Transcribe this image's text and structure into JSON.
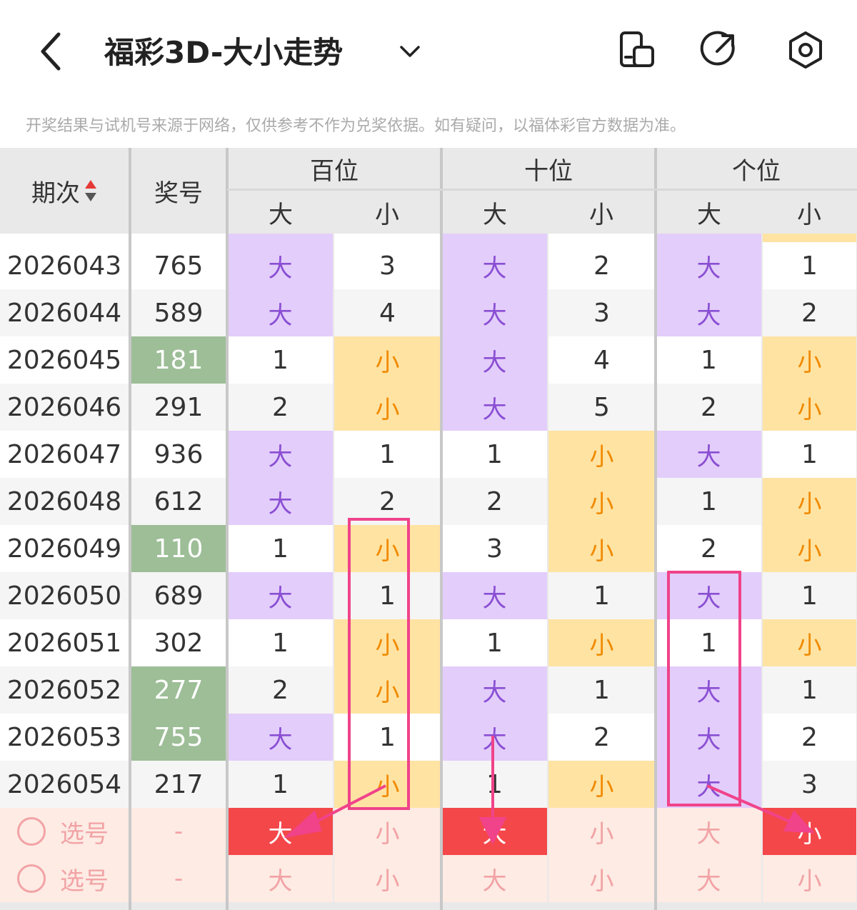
{
  "header": {
    "title": "福彩3D-大小走势",
    "icons": [
      "back-icon",
      "chevron-down-icon",
      "device-icon",
      "share-icon",
      "settings-icon"
    ]
  },
  "disclaimer": "开奖结果与试机号来源于网络，仅供参考不作为兑奖依据。如有疑问，以福体彩官方数据为准。",
  "table": {
    "col_period": "期次",
    "col_number": "奖号",
    "groups": [
      "百位",
      "十位",
      "个位"
    ],
    "sub_big": "大",
    "sub_small": "小",
    "rows": [
      {
        "period": "2026043",
        "number": "765",
        "green": false,
        "cells": [
          "大",
          "3",
          "大",
          "2",
          "大",
          "1"
        ]
      },
      {
        "period": "2026044",
        "number": "589",
        "green": false,
        "cells": [
          "大",
          "4",
          "大",
          "3",
          "大",
          "2"
        ]
      },
      {
        "period": "2026045",
        "number": "181",
        "green": true,
        "cells": [
          "1",
          "小",
          "大",
          "4",
          "1",
          "小"
        ]
      },
      {
        "period": "2026046",
        "number": "291",
        "green": false,
        "cells": [
          "2",
          "小",
          "大",
          "5",
          "2",
          "小"
        ]
      },
      {
        "period": "2026047",
        "number": "936",
        "green": false,
        "cells": [
          "大",
          "1",
          "1",
          "小",
          "大",
          "1"
        ]
      },
      {
        "period": "2026048",
        "number": "612",
        "green": false,
        "cells": [
          "大",
          "2",
          "2",
          "小",
          "1",
          "小"
        ]
      },
      {
        "period": "2026049",
        "number": "110",
        "green": true,
        "cells": [
          "1",
          "小",
          "3",
          "小",
          "2",
          "小"
        ]
      },
      {
        "period": "2026050",
        "number": "689",
        "green": false,
        "cells": [
          "大",
          "1",
          "大",
          "1",
          "大",
          "1"
        ]
      },
      {
        "period": "2026051",
        "number": "302",
        "green": false,
        "cells": [
          "1",
          "小",
          "1",
          "小",
          "1",
          "小"
        ]
      },
      {
        "period": "2026052",
        "number": "277",
        "green": true,
        "cells": [
          "2",
          "小",
          "大",
          "1",
          "大",
          "1"
        ]
      },
      {
        "period": "2026053",
        "number": "755",
        "green": true,
        "cells": [
          "大",
          "1",
          "大",
          "2",
          "大",
          "2"
        ]
      },
      {
        "period": "2026054",
        "number": "217",
        "green": false,
        "cells": [
          "1",
          "小",
          "1",
          "小",
          "大",
          "3"
        ]
      }
    ],
    "pick_rows": [
      {
        "label": "选号",
        "number": "-",
        "cells": [
          "大",
          "小",
          "大",
          "小",
          "大",
          "小"
        ],
        "selected": [
          true,
          false,
          true,
          false,
          false,
          true
        ]
      },
      {
        "label": "选号",
        "number": "-",
        "cells": [
          "大",
          "小",
          "大",
          "小",
          "大",
          "小"
        ],
        "selected": [
          false,
          false,
          false,
          false,
          false,
          false
        ]
      }
    ]
  },
  "colors": {
    "big_bg": "#e3cdfb",
    "small_bg": "#ffe3a3",
    "big_text": "#8a4fd3",
    "small_text": "#f08a00",
    "green_number_bg": "#9dbe97",
    "pick_selected": "#f4474a",
    "annotation": "#f0438a"
  }
}
